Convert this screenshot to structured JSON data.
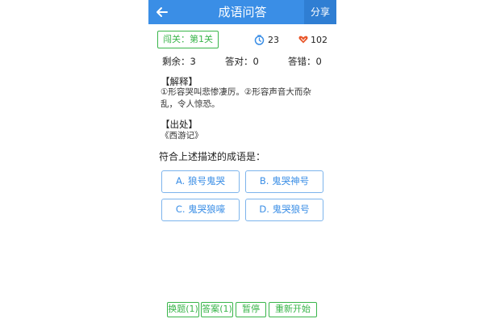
{
  "app_bar": {
    "title": "成语问答",
    "share_label": "分享"
  },
  "status": {
    "level": "闯关：第1关",
    "timer": "23",
    "points": "102"
  },
  "stats": {
    "remaining": "剩余：3",
    "correct": "答对：0",
    "wrong": "答错：0"
  },
  "explanation": {
    "heading": "【解释】",
    "text": "①形容哭叫悲惨凄厉。②形容声音大而杂乱，令人惊恐。"
  },
  "source": {
    "heading": "【出处】",
    "text": "《西游记》"
  },
  "question": "符合上述描述的成语是：",
  "answers": [
    "A. 狼号鬼哭",
    "B. 鬼哭神号",
    "C. 鬼哭狼嚎",
    "D. 鬼哭狼号"
  ],
  "controls": {
    "skip": "换题(1)",
    "hint": "答案(1)",
    "pause": "暂停",
    "restart": "重新开始"
  },
  "colors": {
    "primary": "#3a8ee6",
    "success": "#39b54a",
    "heart": "#e8562a"
  },
  "icons": {
    "back": "arrow-left-icon",
    "timer": "stopwatch-icon",
    "points": "heart-icon"
  }
}
